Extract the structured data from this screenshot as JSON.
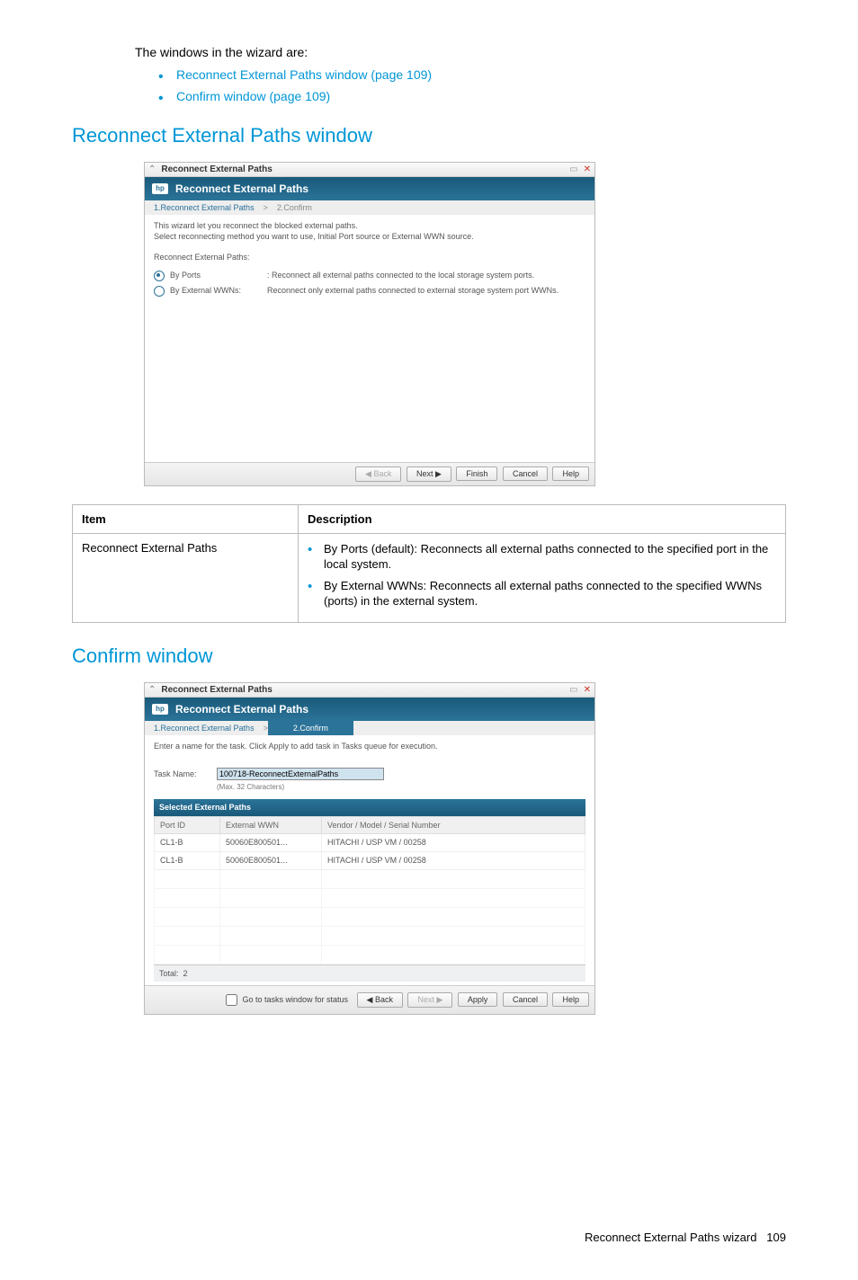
{
  "intro": "The windows in the wizard are:",
  "intro_links": [
    "Reconnect External Paths window (page 109)",
    "Confirm window (page 109)"
  ],
  "section1": {
    "heading": "Reconnect External Paths window",
    "window": {
      "titlebar": "Reconnect External Paths",
      "bluebar": "Reconnect External Paths",
      "logo": "hp",
      "steps": {
        "s1": "1.Reconnect External Paths",
        "sep": ">",
        "s2": "2.Confirm"
      },
      "instr1": "This wizard let you reconnect the blocked external paths.",
      "instr2": "Select reconnecting method you want to use, Initial Port source or External WWN source.",
      "group_label": "Reconnect External Paths:",
      "opt1": {
        "label": "By Ports",
        "desc": ": Reconnect all external paths connected to the local storage system ports."
      },
      "opt2": {
        "label": "By External WWNs:",
        "desc": "Reconnect only external paths connected to external storage system port WWNs."
      },
      "buttons": {
        "back": "◀ Back",
        "next": "Next ▶",
        "finish": "Finish",
        "cancel": "Cancel",
        "help": "Help"
      }
    }
  },
  "table": {
    "h1": "Item",
    "h2": "Description",
    "row_item": "Reconnect External Paths",
    "row_desc": [
      "By Ports (default): Reconnects all external paths connected to the specified port in the local system.",
      "By External WWNs: Reconnects all external paths connected to the specified WWNs (ports) in the external system."
    ]
  },
  "section2": {
    "heading": "Confirm window",
    "window": {
      "titlebar": "Reconnect External Paths",
      "bluebar": "Reconnect External Paths",
      "logo": "hp",
      "steps": {
        "s1": "1.Reconnect External Paths",
        "sep": ">",
        "s2": "2.Confirm"
      },
      "instr": "Enter a name for the task. Click Apply to add task in Tasks queue for execution.",
      "task_label": "Task Name:",
      "task_value": "100718-ReconnectExternalPaths",
      "task_note": "(Max. 32 Characters)",
      "table_title": "Selected External Paths",
      "cols": {
        "c1": "Port ID",
        "c2": "External WWN",
        "c3": "Vendor / Model / Serial Number"
      },
      "rows": [
        {
          "c1": "CL1-B",
          "c2": "50060E800501...",
          "c3": "HITACHI / USP VM / 00258"
        },
        {
          "c1": "CL1-B",
          "c2": "50060E800501...",
          "c3": "HITACHI / USP VM / 00258"
        }
      ],
      "total_label": "Total:",
      "total_value": "2",
      "footer": {
        "check": "Go to tasks window for status",
        "back": "◀ Back",
        "next": "Next ▶",
        "apply": "Apply",
        "cancel": "Cancel",
        "help": "Help"
      }
    }
  },
  "pagefoot": {
    "label": "Reconnect External Paths wizard",
    "num": "109"
  }
}
